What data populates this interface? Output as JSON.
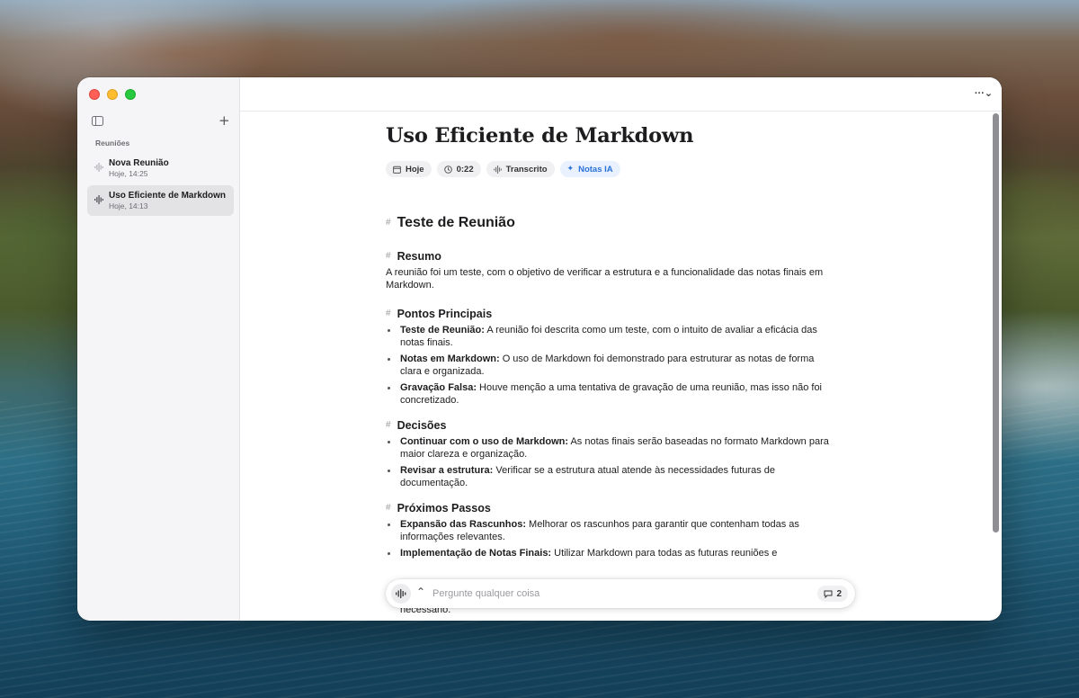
{
  "sidebar": {
    "section_label": "Reuniões",
    "add_symbol": "+",
    "items": [
      {
        "title": "Nova Reunião",
        "subtitle": "Hoje, 14:25"
      },
      {
        "title": "Uso Eficiente de Markdown",
        "subtitle": "Hoje, 14:13"
      }
    ]
  },
  "toolbar": {
    "more_label": "···⌄"
  },
  "document": {
    "title": "Uso Eficiente de Markdown",
    "chips": [
      {
        "icon": "calendar-icon",
        "label": "Hoje"
      },
      {
        "icon": "clock-icon",
        "label": "0:22"
      },
      {
        "icon": "waveform-icon",
        "label": "Transcrito"
      },
      {
        "icon": "sparkle-icon",
        "label": "Notas IA"
      }
    ],
    "heading_marker": "#",
    "h1": "Teste de Reunião",
    "sections": {
      "resumo": {
        "heading": "Resumo",
        "text": "A reunião foi um teste, com o objetivo de verificar a estrutura e a funcionalidade das notas finais em Markdown."
      },
      "pontos": {
        "heading": "Pontos Principais",
        "items": [
          {
            "bold": "Teste de Reunião:",
            "text": " A reunião foi descrita como um teste, com o intuito de avaliar a eficácia das notas finais."
          },
          {
            "bold": "Notas em Markdown:",
            "text": " O uso de Markdown foi demonstrado para estruturar as notas de forma clara e organizada."
          },
          {
            "bold": "Gravação Falsa:",
            "text": " Houve menção a uma tentativa de gravação de uma reunião, mas isso não foi concretizado."
          }
        ]
      },
      "decisoes": {
        "heading": "Decisões",
        "items": [
          {
            "bold": "Continuar com o uso de Markdown:",
            "text": " As notas finais serão baseadas no formato Markdown para maior clareza e organização."
          },
          {
            "bold": "Revisar a estrutura:",
            "text": " Verificar se a estrutura atual atende às necessidades futuras de documentação."
          }
        ]
      },
      "passos": {
        "heading": "Próximos Passos",
        "items": [
          {
            "bold": "Expansão das Rascunhos:",
            "text": " Melhorar os rascunhos para garantir que contenham todas as informações relevantes."
          },
          {
            "bold": "Implementação de Notas Finais:",
            "text": " Utilizar Markdown para todas as futuras reuniões e"
          }
        ],
        "cutoff_text": "necessário."
      }
    }
  },
  "askbar": {
    "chevron": "⌃",
    "placeholder": "Pergunte qualquer coisa",
    "comment_count": "2"
  },
  "colors": {
    "accent_blue": "#2a72d8",
    "traffic_red": "#ff5f57",
    "traffic_yellow": "#febc2e",
    "traffic_green": "#28c840"
  }
}
